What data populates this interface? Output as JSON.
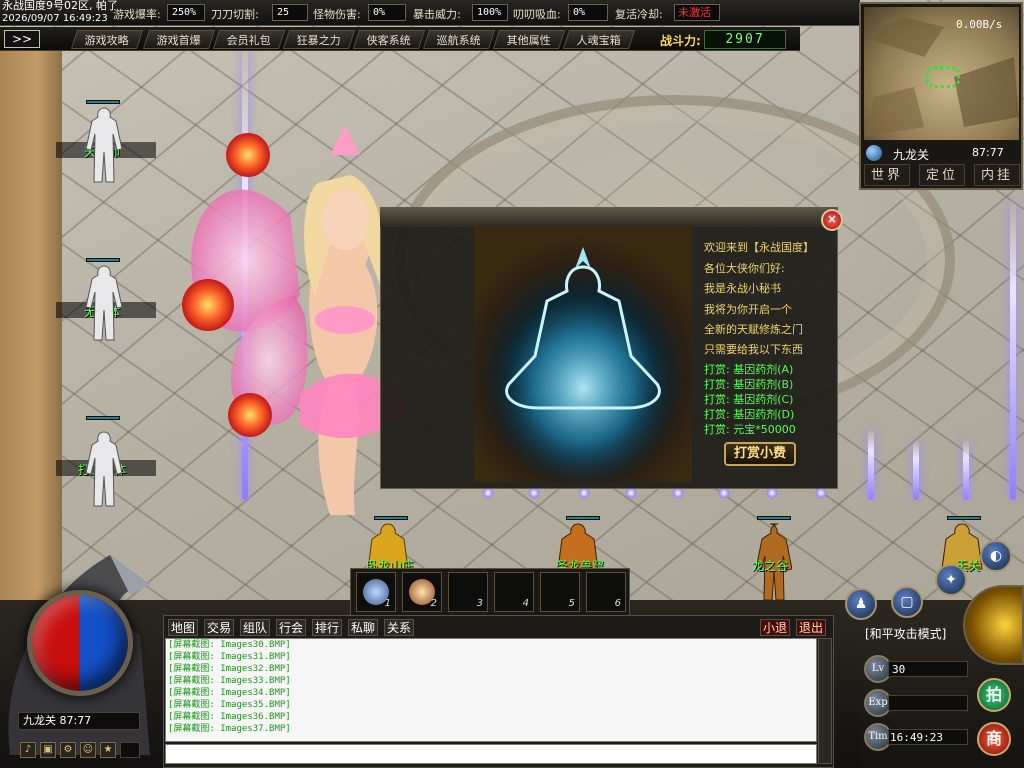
{
  "top": {
    "server_line1": "永战国度9号02区, 帕了",
    "server_line2": "2026/09/07 16:49:23",
    "stats": [
      {
        "label": "游戏爆率:",
        "value": "250%"
      },
      {
        "label": "刀刀切割:",
        "value": "25"
      },
      {
        "label": "怪物伤害:",
        "value": "0%"
      },
      {
        "label": "暴击威力:",
        "value": "100%"
      },
      {
        "label": "叨叨吸血:",
        "value": "0%"
      },
      {
        "label": "复活冷却:",
        "value": "未激活"
      }
    ]
  },
  "nav": {
    "toggle": ">>",
    "tabs": [
      "游戏攻略",
      "游戏首爆",
      "会员礼包",
      "狂暴之力",
      "侠客系统",
      "巡航系统",
      "其他属性",
      "人魂宝箱"
    ],
    "power_label": "战斗力:",
    "power_value": "2907"
  },
  "minimap": {
    "speed": "0.00B/s",
    "map_name": "九龙关",
    "coords": "87:77",
    "buttons": [
      "世界",
      "定位",
      "内挂"
    ]
  },
  "npcs_left": [
    "天命师",
    "无垢体",
    "打工神体"
  ],
  "npcs_bottom": [
    "卧龙山庄",
    "圣龙兽窟",
    "龙之谷",
    "天关"
  ],
  "dialog": {
    "close": "×",
    "lines_yellow": [
      "欢迎来到【永战国度】",
      "各位大侠你们好:",
      "我是永战小秘书",
      "我将为你开启一个",
      "全新的天赋修炼之门",
      "只需要给我以下东西"
    ],
    "lines_green": [
      "打赏: 基因药剂(A)",
      "打赏: 基因药剂(B)",
      "打赏: 基因药剂(C)",
      "打赏: 基因药剂(D)",
      "打赏: 元宝*50000"
    ],
    "button": "打赏小费"
  },
  "skills": {
    "slots": [
      "1",
      "2",
      "3",
      "4",
      "5",
      "6"
    ]
  },
  "chat": {
    "tabs": [
      "地图",
      "交易",
      "组队",
      "行会",
      "排行",
      "私聊",
      "关系"
    ],
    "right_tabs": [
      "小退",
      "退出"
    ],
    "lines": [
      "[屏幕截图: Images30.BMP]",
      "[屏幕截图: Images31.BMP]",
      "[屏幕截图: Images32.BMP]",
      "[屏幕截图: Images33.BMP]",
      "[屏幕截图: Images34.BMP]",
      "[屏幕截图: Images35.BMP]",
      "[屏幕截图: Images36.BMP]",
      "[屏幕截图: Images37.BMP]"
    ]
  },
  "player": {
    "location": "九龙关  87:77",
    "mode": "[和平攻击模式]",
    "lv_label": "Lv",
    "lv": "30",
    "exp_label": "Exp",
    "tim_label": "Tim",
    "time": "16:49:23",
    "btn_auction": "拍",
    "btn_shop": "商"
  },
  "colors": {
    "hp": "#c60f0f",
    "mp": "#1451c9",
    "npc_name": "#5dff5d",
    "dialog_yellow": "#f2d36a",
    "dialog_green": "#53ff53",
    "power": "#7dff7d"
  }
}
